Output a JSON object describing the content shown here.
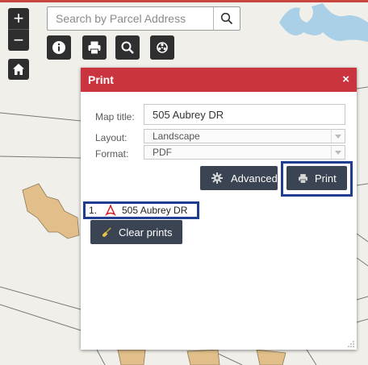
{
  "search": {
    "placeholder": "Search by Parcel Address"
  },
  "zoom": {
    "in_label": "+",
    "out_label": "−"
  },
  "toolbar": {
    "items": [
      {
        "icon": "info-icon"
      },
      {
        "icon": "printer-icon"
      },
      {
        "icon": "magnifier-icon"
      },
      {
        "icon": "layers-icon"
      }
    ]
  },
  "print_panel": {
    "title": "Print",
    "close_label": "×",
    "map_title_label": "Map title:",
    "map_title_value": "505 Aubrey DR",
    "layout_label": "Layout:",
    "layout_value": "Landscape",
    "format_label": "Format:",
    "format_value": "PDF",
    "advanced_label": "Advanced",
    "print_label": "Print",
    "results": [
      {
        "index": "1.",
        "name": "505 Aubrey DR"
      }
    ],
    "clear_label": "Clear prints"
  },
  "colors": {
    "panel_header": "#c9343f",
    "highlight": "#1f3e8f",
    "dark_button": "#3a4452"
  }
}
